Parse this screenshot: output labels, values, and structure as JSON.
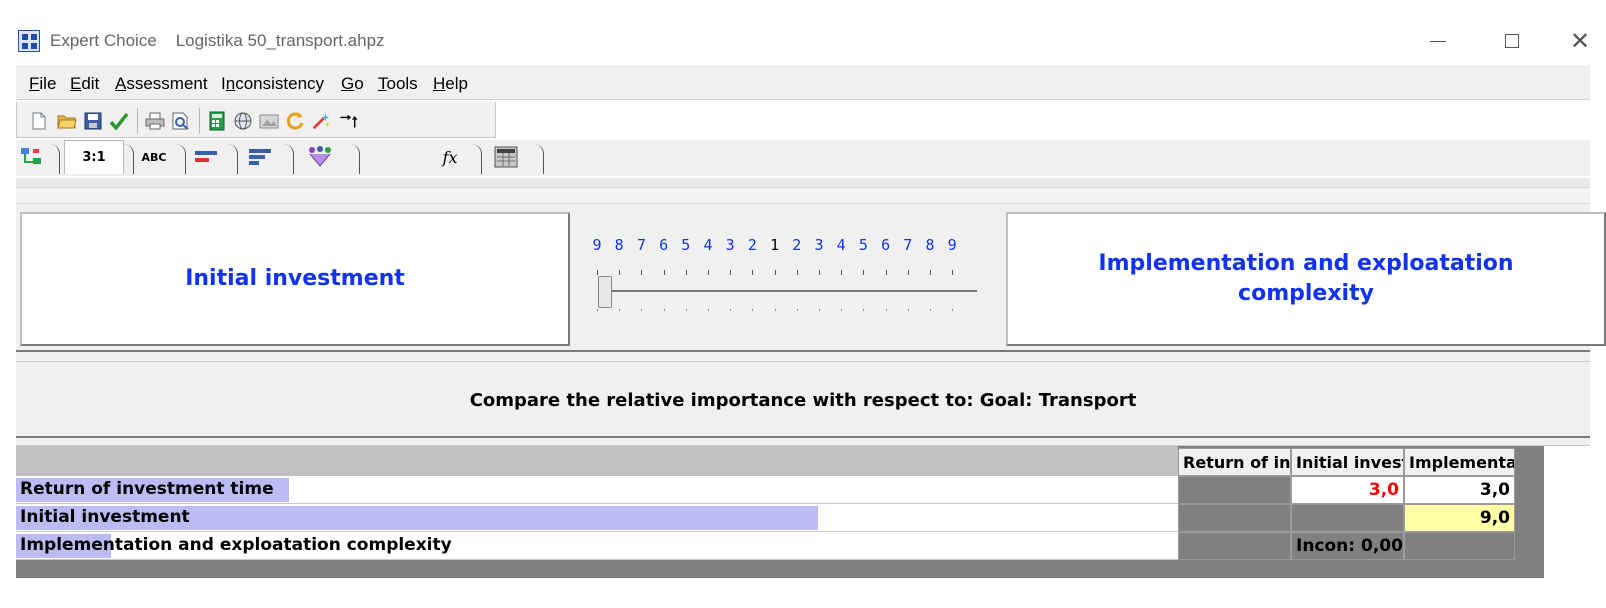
{
  "window": {
    "app_name": "Expert Choice",
    "file_name": "Logistika 50_transport.ahpz",
    "minimize_glyph": "–",
    "maximize_glyph": "□",
    "close_glyph": "✕"
  },
  "menu": [
    {
      "label": "File",
      "mnemonic": "F",
      "rest": "ile"
    },
    {
      "label": "Edit",
      "mnemonic": "E",
      "rest": "dit"
    },
    {
      "label": "Assessment",
      "mnemonic": "A",
      "rest": "ssessment"
    },
    {
      "label": "Inconsistency",
      "prefix": "I",
      "mnemonic": "n",
      "rest": "consistency"
    },
    {
      "label": "Go",
      "mnemonic": "G",
      "rest": "o"
    },
    {
      "label": "Tools",
      "mnemonic": "T",
      "rest": "ools"
    },
    {
      "label": "Help",
      "mnemonic": "H",
      "rest": "elp"
    }
  ],
  "toolbar_icons": [
    "new-file-icon",
    "open-folder-icon",
    "save-icon",
    "check-icon",
    "print-icon",
    "print-preview-icon",
    "calculator-icon",
    "globe-icon",
    "image-icon",
    "refresh-icon",
    "wand-icon",
    "arrows-icon"
  ],
  "tabs": [
    {
      "name": "tree-view-tab",
      "label": ""
    },
    {
      "name": "ratio-tab",
      "label": "3:1"
    },
    {
      "name": "verbal-tab",
      "label": "ABC"
    },
    {
      "name": "graphical-tab",
      "label": ""
    },
    {
      "name": "questionnaire-tab",
      "label": ""
    },
    {
      "name": "formula-tab",
      "label": ""
    },
    {
      "name": "fx-tab",
      "label": "fx"
    },
    {
      "name": "spreadsheet-tab",
      "label": ""
    }
  ],
  "comparison": {
    "left": "Initial investment",
    "right": "Implementation and exploatation complexity",
    "scale": [
      "9",
      "8",
      "7",
      "6",
      "5",
      "4",
      "3",
      "2",
      "1",
      "2",
      "3",
      "4",
      "5",
      "6",
      "7",
      "8",
      "9"
    ],
    "slider_value": "9",
    "prompt": "Compare the relative importance with respect to: Goal: Transport"
  },
  "matrix": {
    "columns": [
      "Return of investment time",
      "Initial investment",
      "Implementation and exploatation complexity"
    ],
    "rows": [
      {
        "label": "Return of investment time",
        "bar_fraction": 0.235,
        "cells": [
          "",
          "3,0",
          "3,0"
        ]
      },
      {
        "label": "Initial investment",
        "bar_fraction": 0.69,
        "cells": [
          "",
          "",
          "9,0"
        ]
      },
      {
        "label": "Implementation and exploatation complexity",
        "bar_fraction": 0.082,
        "cells": [
          "",
          "Incon: 0,00",
          ""
        ]
      }
    ]
  },
  "colors": {
    "accent_blue": "#1133ee",
    "inverse_red": "#ff0000",
    "highlight_yellow": "#ffffa8",
    "bar_lavender": "#bcbcf4"
  }
}
